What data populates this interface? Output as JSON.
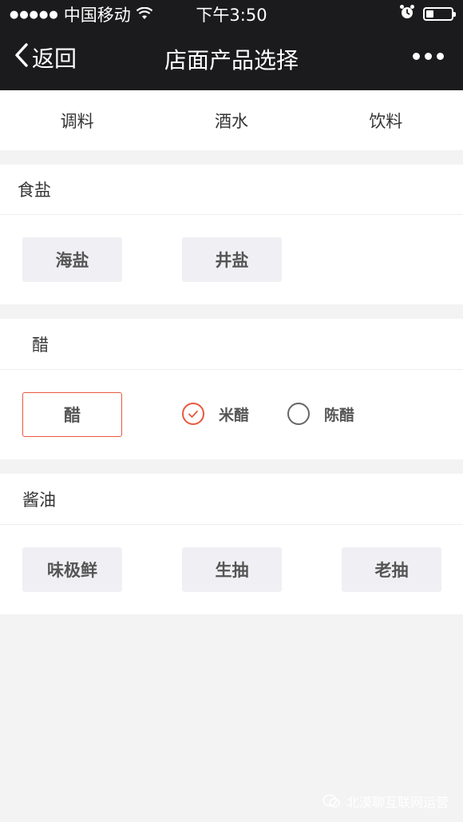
{
  "status_bar": {
    "signal_dots": "●●●●●",
    "carrier": "中国移动",
    "time": "下午3:50",
    "wifi_icon": "wifi-icon",
    "alarm_icon": "alarm-icon",
    "battery_level": 0.3
  },
  "nav": {
    "back_label": "返回",
    "title": "店面产品选择",
    "more_icon": "more-icon"
  },
  "tabs": [
    {
      "label": "调料"
    },
    {
      "label": "酒水"
    },
    {
      "label": "饮料"
    }
  ],
  "sections": {
    "salt": {
      "title": "食盐",
      "options": [
        {
          "label": "海盐"
        },
        {
          "label": "井盐"
        }
      ]
    },
    "vinegar": {
      "title": "醋",
      "chip": "醋",
      "radios": [
        {
          "label": "米醋",
          "checked": true
        },
        {
          "label": "陈醋",
          "checked": false
        }
      ]
    },
    "soy": {
      "title": "酱油",
      "options": [
        {
          "label": "味极鲜"
        },
        {
          "label": "生抽"
        },
        {
          "label": "老抽"
        }
      ]
    }
  },
  "watermark": "北漠聊互联网运营",
  "colors": {
    "nav_bg": "#1b1b1d",
    "accent": "#e8593e",
    "chip_bg": "#f0f0f4",
    "page_bg": "#f3f3f3"
  }
}
